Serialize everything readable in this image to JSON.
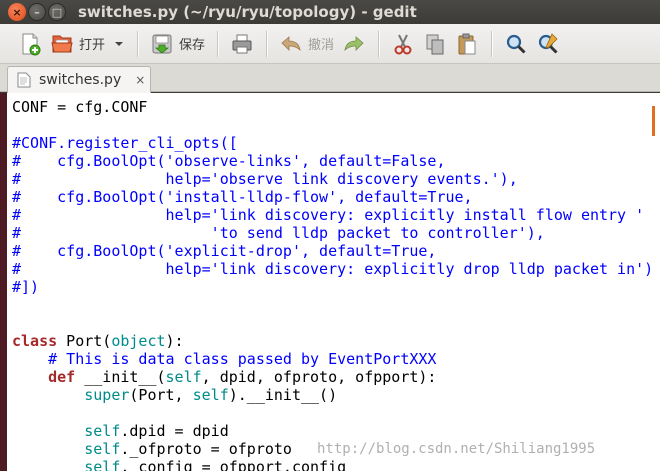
{
  "window": {
    "title": "switches.py (~/ryu/ryu/topology) - gedit",
    "close_glyph": "×",
    "min_glyph": "–",
    "max_glyph": "□"
  },
  "toolbar": {
    "open_label": "打开",
    "save_label": "保存",
    "undo_label": "撤消"
  },
  "tab": {
    "label": "switches.py",
    "close_glyph": "×"
  },
  "editor": {
    "lines": [
      [
        {
          "t": "CONF = cfg.CONF",
          "c": ""
        }
      ],
      [
        {
          "t": "",
          "c": ""
        }
      ],
      [
        {
          "t": "#CONF.register_cli_opts([",
          "c": "comment"
        }
      ],
      [
        {
          "t": "#    cfg.BoolOpt('observe-links', default=False,",
          "c": "comment"
        }
      ],
      [
        {
          "t": "#                help='observe link discovery events.'),",
          "c": "comment"
        }
      ],
      [
        {
          "t": "#    cfg.BoolOpt('install-lldp-flow', default=True,",
          "c": "comment"
        }
      ],
      [
        {
          "t": "#                help='link discovery: explicitly install flow entry '",
          "c": "comment"
        }
      ],
      [
        {
          "t": "#                     'to send lldp packet to controller'),",
          "c": "comment"
        }
      ],
      [
        {
          "t": "#    cfg.BoolOpt('explicit-drop', default=True,",
          "c": "comment"
        }
      ],
      [
        {
          "t": "#                help='link discovery: explicitly drop lldp packet in')",
          "c": "comment"
        }
      ],
      [
        {
          "t": "#])",
          "c": "comment"
        }
      ],
      [
        {
          "t": "",
          "c": ""
        }
      ],
      [
        {
          "t": "",
          "c": ""
        }
      ],
      [
        {
          "t": "class",
          "c": "kw"
        },
        {
          "t": " Port(",
          "c": ""
        },
        {
          "t": "object",
          "c": "builtin"
        },
        {
          "t": "):",
          "c": ""
        }
      ],
      [
        {
          "t": "    ",
          "c": ""
        },
        {
          "t": "# This is data class passed by EventPortXXX",
          "c": "comment"
        }
      ],
      [
        {
          "t": "    ",
          "c": ""
        },
        {
          "t": "def",
          "c": "kw"
        },
        {
          "t": " __init__(",
          "c": ""
        },
        {
          "t": "self",
          "c": "builtin"
        },
        {
          "t": ", dpid, ofproto, ofpport):",
          "c": ""
        }
      ],
      [
        {
          "t": "        ",
          "c": ""
        },
        {
          "t": "super",
          "c": "builtin"
        },
        {
          "t": "(Port, ",
          "c": ""
        },
        {
          "t": "self",
          "c": "builtin"
        },
        {
          "t": ").__init__()",
          "c": ""
        }
      ],
      [
        {
          "t": "",
          "c": ""
        }
      ],
      [
        {
          "t": "        ",
          "c": ""
        },
        {
          "t": "self",
          "c": "builtin"
        },
        {
          "t": ".dpid = dpid",
          "c": ""
        }
      ],
      [
        {
          "t": "        ",
          "c": ""
        },
        {
          "t": "self",
          "c": "builtin"
        },
        {
          "t": "._ofproto = ofproto",
          "c": ""
        }
      ],
      [
        {
          "t": "        ",
          "c": ""
        },
        {
          "t": "self",
          "c": "builtin"
        },
        {
          "t": "._config = ofpport.config",
          "c": ""
        }
      ]
    ]
  },
  "watermark": "http://blog.csdn.net/Shiliang1995",
  "colors": {
    "comment": "#0000ff",
    "keyword": "#a52a2a",
    "builtin": "#008b8b",
    "close_button": "#df4a16"
  }
}
